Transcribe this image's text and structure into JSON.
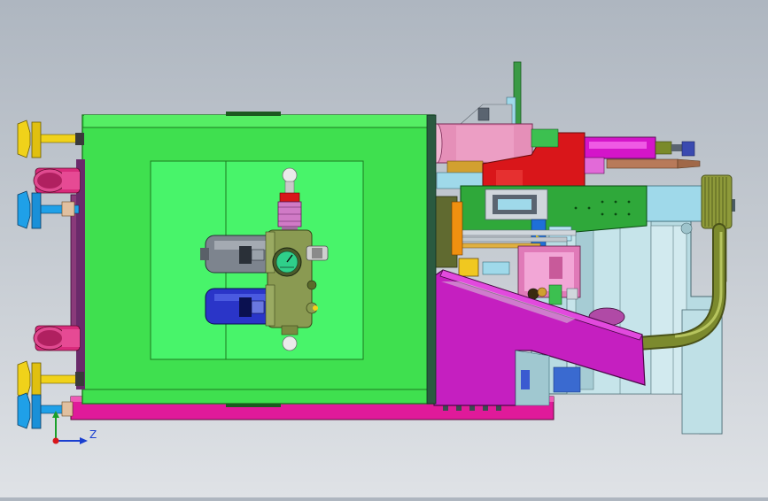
{
  "viewport": {
    "background_top": "#aeb6c0",
    "background_bottom": "#dfe2e6"
  },
  "model": {
    "colors": {
      "main_box": "#3fe04f",
      "main_box_edge": "#1d7a20",
      "panel": "#48f46a",
      "base_plate": "#e01a9a",
      "pink_hinge": "#d92b7c",
      "yellow_foot": "#f0d21a",
      "blue_foot": "#1fa0e8",
      "chute": "#c51fc0",
      "motor_body": "#b8dbe2",
      "tube": "#7c8a2e",
      "regulator_body": "#8a9a52",
      "filter_bowl_grey": "#7d848e",
      "filter_bowl_blue": "#2a35c8",
      "gauge_face": "#2fcf8a",
      "red_block": "#d9161a",
      "pink_drum": "#e58fb8",
      "green_plate": "#2fa83a",
      "magenta_nozzle": "#d415c9"
    },
    "icons": [
      "triad-axis-icon"
    ]
  },
  "axis_triad": {
    "z_label": "Z"
  }
}
